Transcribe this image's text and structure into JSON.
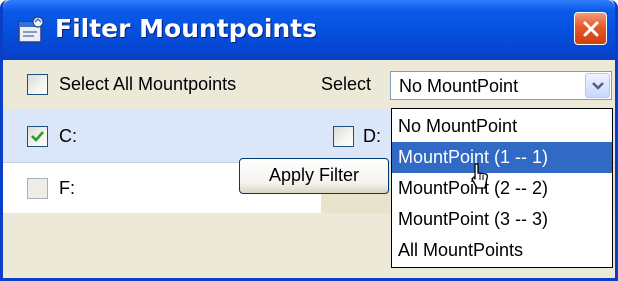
{
  "window": {
    "title": "Filter Mountpoints",
    "close_icon": "close-icon",
    "app_icon": "filter-window-icon"
  },
  "toolbar": {
    "select_all_label": "Select All Mountpoints",
    "select_all_checked": false,
    "select_label": "Select",
    "select_value": "No MountPoint"
  },
  "drives": [
    {
      "label": "C:",
      "checked": true
    },
    {
      "label": "D:",
      "checked": false
    },
    {
      "label": "F:",
      "checked": false
    }
  ],
  "dropdown": {
    "options": [
      "No MountPoint",
      "MountPoint  (1 -- 1)",
      "MountPoint  (2 -- 2)",
      "MountPoint  (3 -- 3)",
      "All MountPoints"
    ],
    "highlighted_index": 1
  },
  "actions": {
    "apply_label": "Apply Filter"
  },
  "colors": {
    "title_bar": "#0551de",
    "selection": "#316ac5",
    "close_button": "#e55a2a"
  }
}
